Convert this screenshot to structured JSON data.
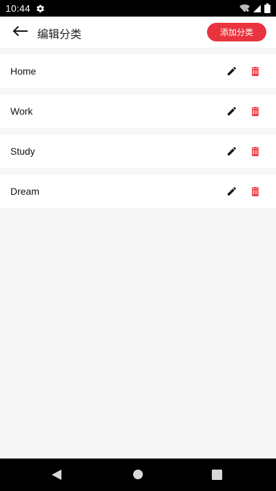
{
  "status_bar": {
    "time": "10:44",
    "icons": [
      "settings-gear-icon",
      "wifi-icon",
      "signal-icon",
      "battery-icon"
    ]
  },
  "header": {
    "back_icon": "arrow-left-icon",
    "title": "编辑分类",
    "add_button_label": "添加分类"
  },
  "categories": [
    {
      "label": "Home"
    },
    {
      "label": "Work"
    },
    {
      "label": "Study"
    },
    {
      "label": "Dream"
    }
  ],
  "item_icons": {
    "edit": "pencil-icon",
    "delete": "trash-icon"
  },
  "colors": {
    "accent": "#e8343f",
    "background": "#f6f6f6",
    "card": "#ffffff",
    "system_bars": "#000000"
  },
  "nav_bar": {
    "icons": [
      "nav-back-icon",
      "nav-home-icon",
      "nav-recents-icon"
    ]
  }
}
